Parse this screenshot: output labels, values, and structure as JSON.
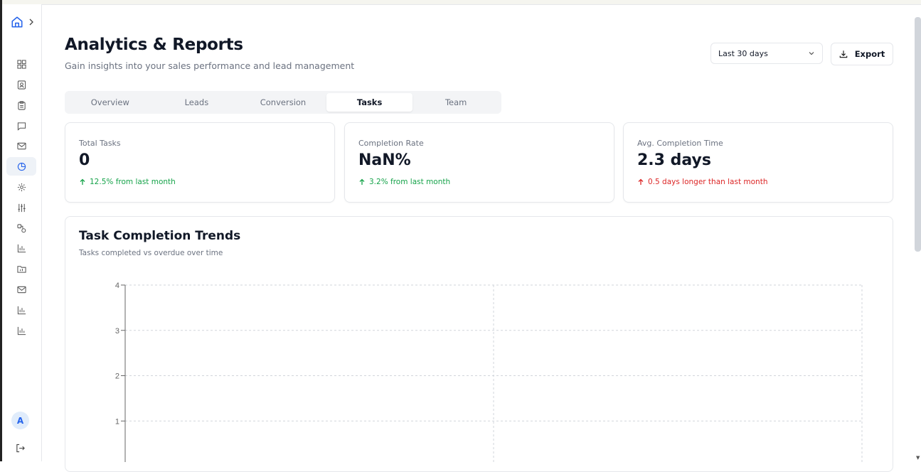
{
  "header": {
    "title": "Analytics & Reports",
    "subtitle": "Gain insights into your sales performance and lead management",
    "date_range": "Last 30 days",
    "export_label": "Export"
  },
  "sidebar": {
    "avatar_initial": "A",
    "items": [
      {
        "icon": "dashboard-icon"
      },
      {
        "icon": "contacts-icon"
      },
      {
        "icon": "clipboard-icon"
      },
      {
        "icon": "chat-icon"
      },
      {
        "icon": "mail-icon"
      },
      {
        "icon": "analytics-pie-icon",
        "active": true
      },
      {
        "icon": "settings-gear-icon"
      },
      {
        "icon": "sliders-icon"
      },
      {
        "icon": "integrations-icon"
      },
      {
        "icon": "bar-chart-icon"
      },
      {
        "icon": "folder-icon"
      },
      {
        "icon": "mail-icon"
      },
      {
        "icon": "bar-chart-icon"
      },
      {
        "icon": "bar-chart-icon"
      }
    ]
  },
  "tabs": [
    {
      "label": "Overview"
    },
    {
      "label": "Leads"
    },
    {
      "label": "Conversion"
    },
    {
      "label": "Tasks",
      "active": true
    },
    {
      "label": "Team"
    }
  ],
  "stats": [
    {
      "label": "Total Tasks",
      "value": "0",
      "delta": "12.5% from last month",
      "trend": "up"
    },
    {
      "label": "Completion Rate",
      "value": "NaN%",
      "delta": "3.2% from last month",
      "trend": "up"
    },
    {
      "label": "Avg. Completion Time",
      "value": "2.3 days",
      "delta": "0.5 days longer than last month",
      "trend": "down"
    }
  ],
  "chart": {
    "title": "Task Completion Trends",
    "subtitle": "Tasks completed vs overdue over time"
  },
  "chart_data": {
    "type": "line",
    "title": "Task Completion Trends",
    "subtitle": "Tasks completed vs overdue over time",
    "y_ticks": [
      4,
      3,
      2,
      1
    ],
    "ylim": [
      0,
      4
    ],
    "grid": true,
    "series": []
  },
  "colors": {
    "accent": "#2563eb",
    "positive": "#16a34a",
    "negative": "#dc2626"
  }
}
